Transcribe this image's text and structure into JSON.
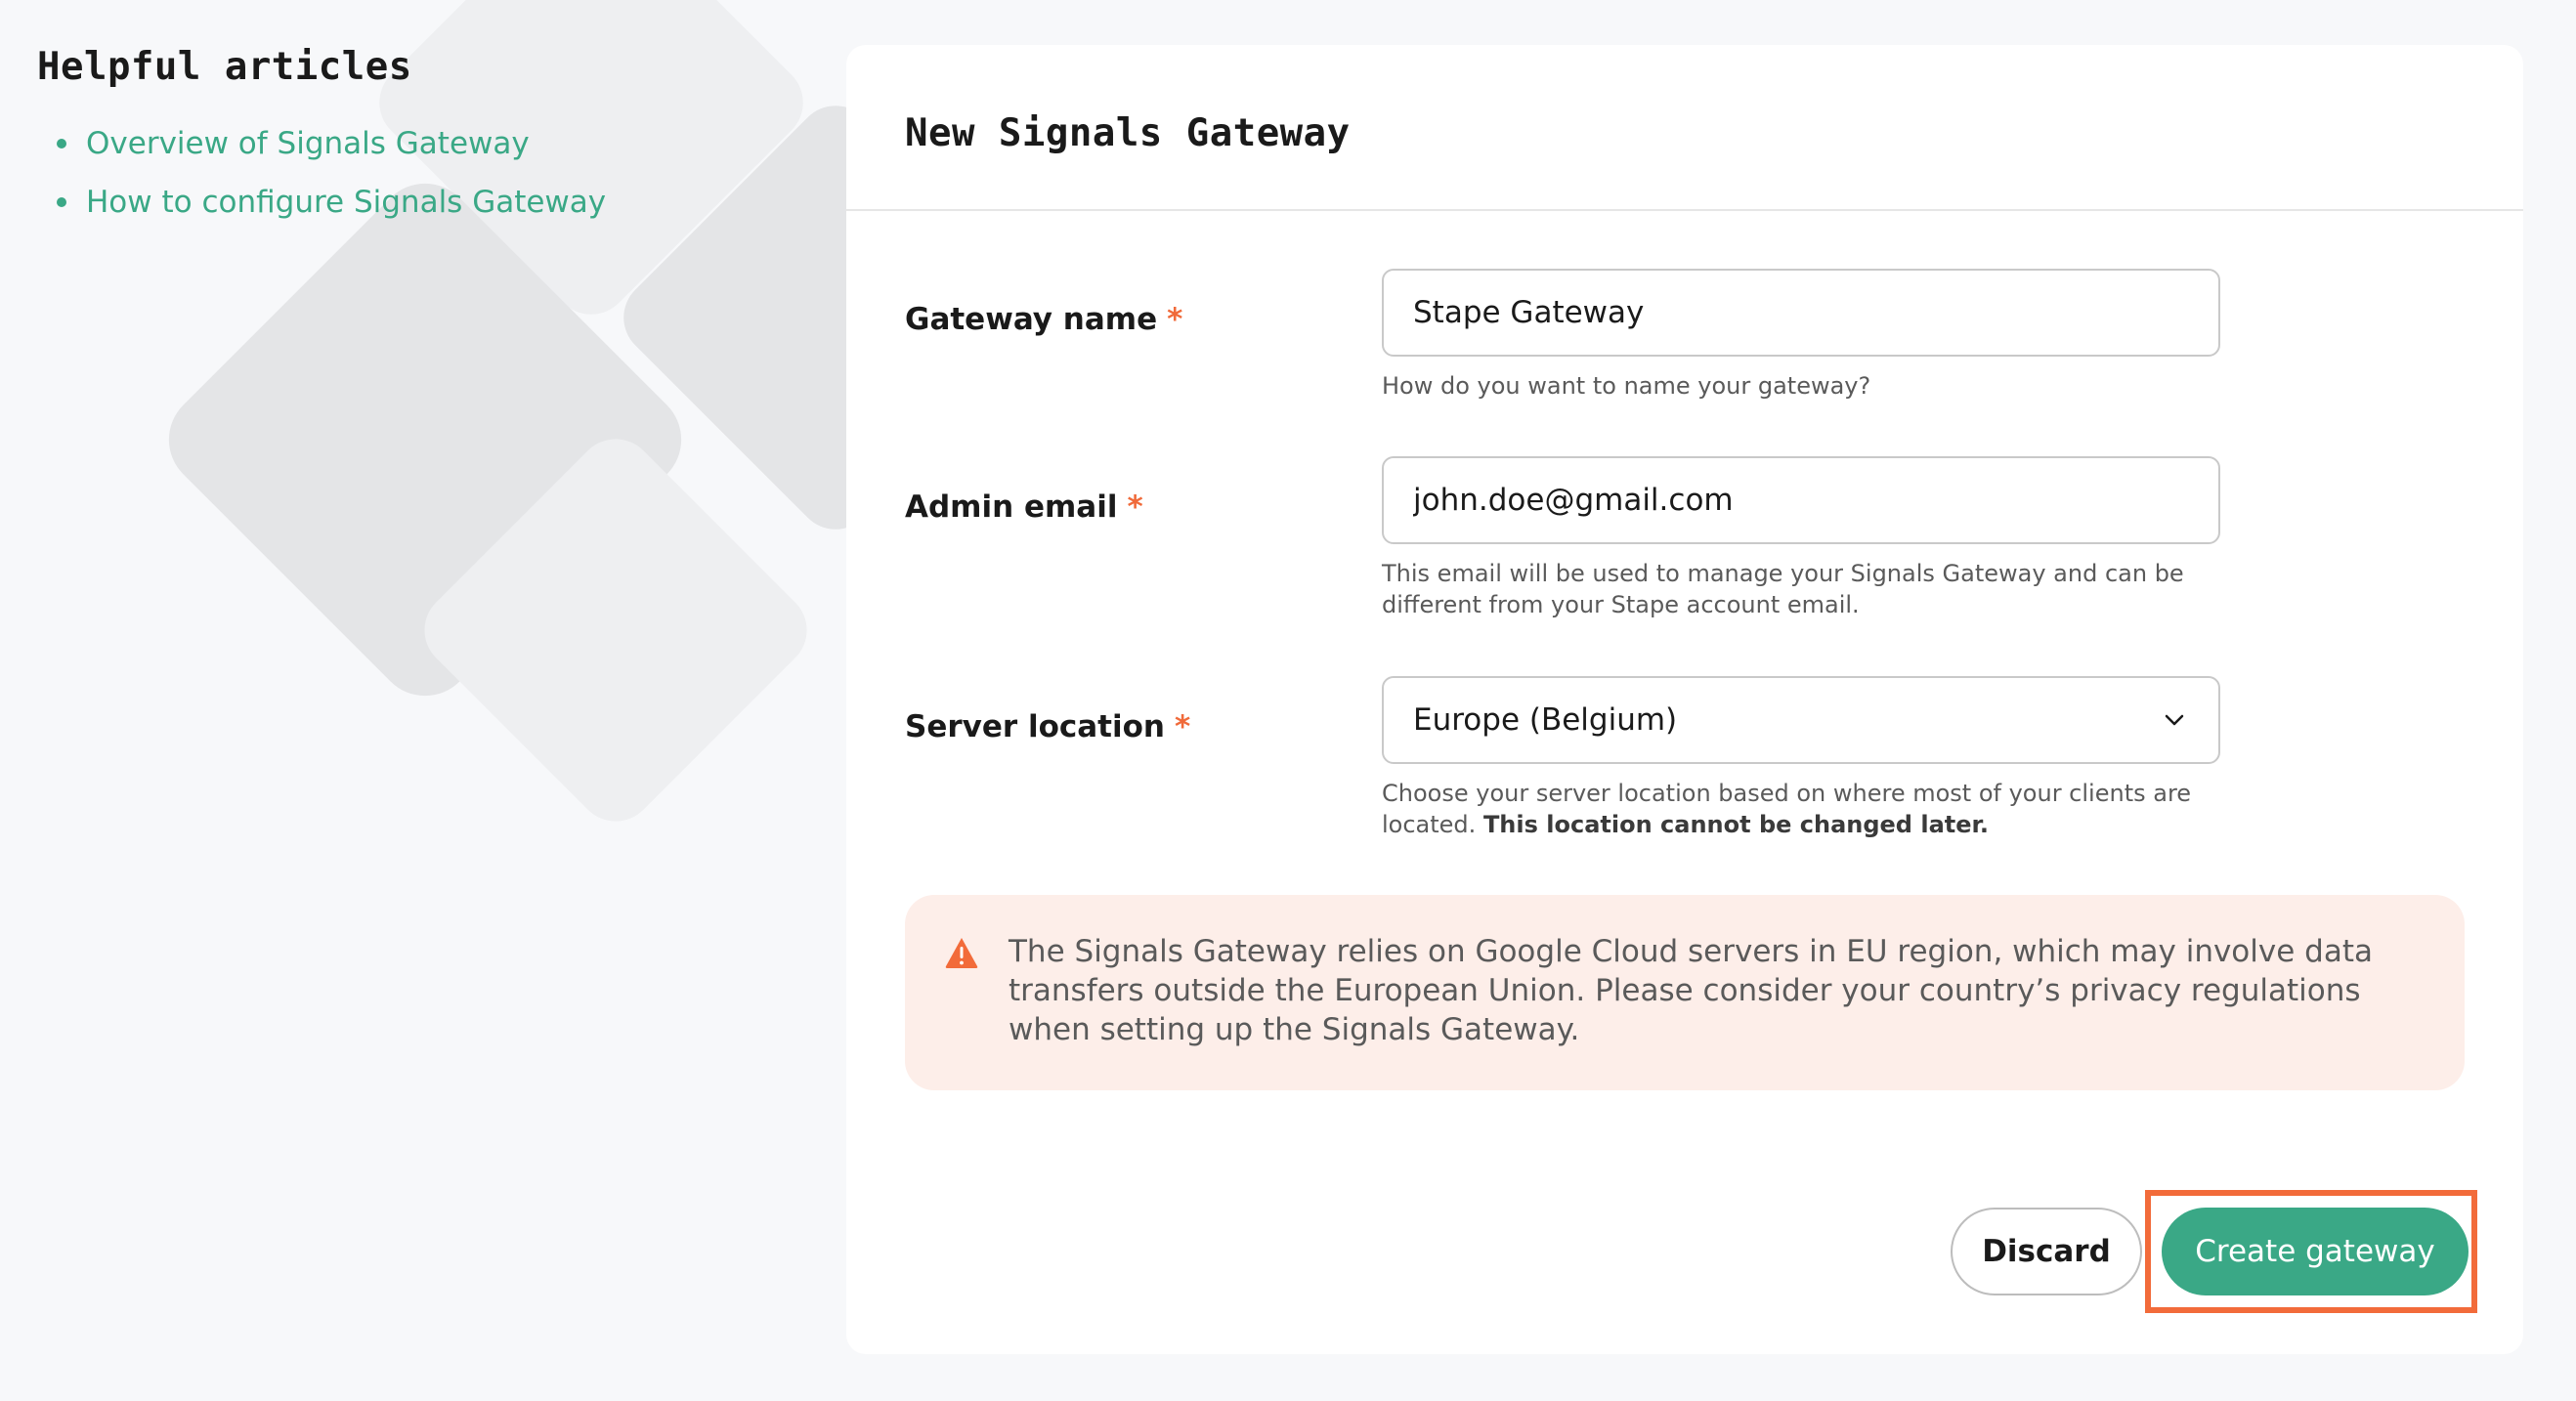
{
  "articles": {
    "title": "Helpful articles",
    "links": [
      {
        "label": "Overview of Signals Gateway"
      },
      {
        "label": "How to configure Signals Gateway"
      }
    ]
  },
  "form": {
    "title": "New Signals Gateway",
    "required_marker": "*",
    "gateway_name": {
      "label": "Gateway name",
      "value": "Stape Gateway",
      "hint": "How do you want to name your gateway?"
    },
    "admin_email": {
      "label": "Admin email",
      "value": "john.doe@gmail.com",
      "hint": "This email will be used to manage your Signals Gateway and can be different from your Stape account email."
    },
    "server_location": {
      "label": "Server location",
      "value": "Europe (Belgium)",
      "hint": "Choose your server location based on where most of your clients are located.",
      "hint_bold": "This location cannot be changed later."
    },
    "alert": {
      "text": "The Signals Gateway relies on Google Cloud servers in EU region, which may involve data transfers outside the European Union. Please consider your country’s privacy regulations when setting up the Signals Gateway."
    },
    "buttons": {
      "discard": "Discard",
      "create": "Create gateway"
    }
  },
  "colors": {
    "accent": "#3aa886",
    "required": "#f06a3a",
    "highlight": "#f26b3a",
    "alert_bg": "#fdeee9",
    "alert_icon": "#f26b3a"
  }
}
